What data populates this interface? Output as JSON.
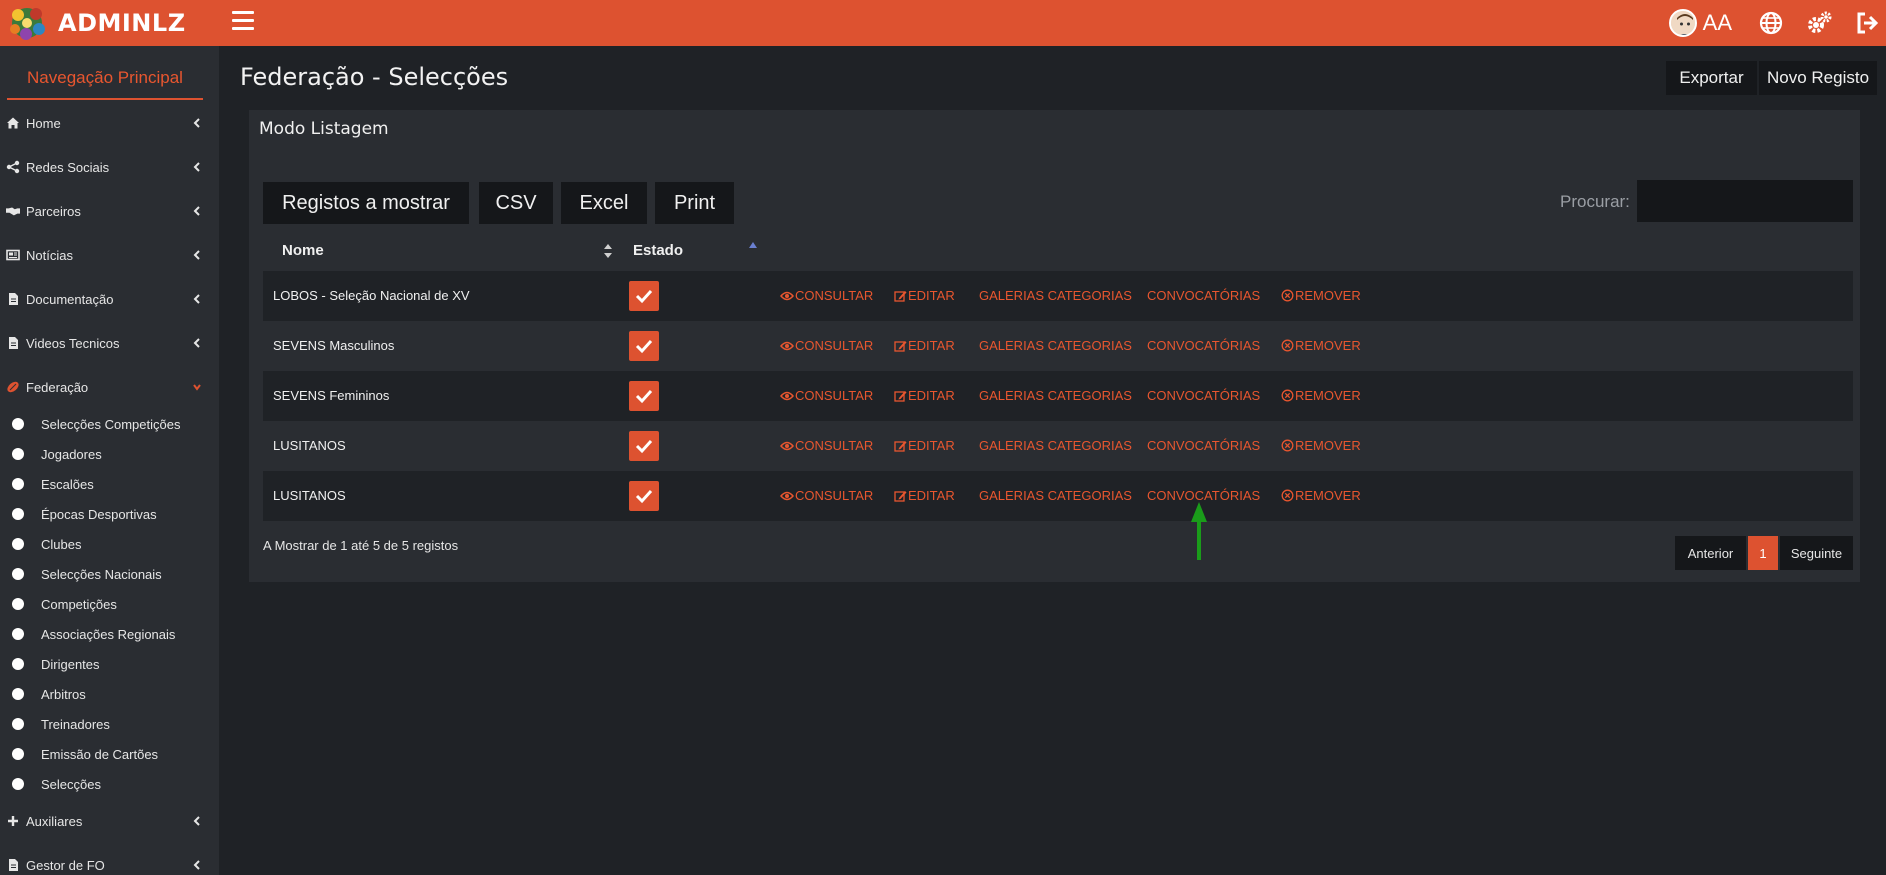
{
  "app": {
    "brand": "ADMINLZ",
    "user_initials": "AA"
  },
  "colors": {
    "accent": "#dd5230",
    "sidebar_bg": "#2a2d32",
    "body_bg": "#1f2226",
    "button_bg": "#15171a",
    "annotation_arrow": "#1a9c1a"
  },
  "sidebar": {
    "title": "Navegação Principal",
    "items": [
      {
        "label": "Home",
        "icon": "home-icon"
      },
      {
        "label": "Redes Sociais",
        "icon": "share-icon"
      },
      {
        "label": "Parceiros",
        "icon": "handshake-icon"
      },
      {
        "label": "Notícias",
        "icon": "newspaper-icon"
      },
      {
        "label": "Documentação",
        "icon": "document-icon"
      },
      {
        "label": "Videos Tecnicos",
        "icon": "document-icon"
      },
      {
        "label": "Federação",
        "icon": "rugby-ball-icon",
        "expanded": true
      },
      {
        "label": "Auxiliares",
        "icon": "plus-icon"
      },
      {
        "label": "Gestor de FO",
        "icon": "document-icon"
      }
    ],
    "federacao_items": [
      "Selecções Competições",
      "Jogadores",
      "Escalões",
      "Épocas Desportivas",
      "Clubes",
      "Selecções Nacionais",
      "Competições",
      "Associações Regionais",
      "Dirigentes",
      "Arbitros",
      "Treinadores",
      "Emissão de Cartões",
      "Selecções"
    ]
  },
  "header": {
    "page_title": "Federação - Selecções",
    "export_label": "Exportar",
    "new_label": "Novo Registo"
  },
  "panel": {
    "title": "Modo Listagem",
    "tools": [
      "Registos a mostrar",
      "CSV",
      "Excel",
      "Print"
    ],
    "search_label": "Procurar:",
    "search_value": ""
  },
  "table": {
    "columns": [
      "Nome",
      "Estado"
    ],
    "actions": [
      "CONSULTAR",
      "EDITAR",
      "GALERIAS CATEGORIAS",
      "CONVOCATÓRIAS",
      "REMOVER"
    ],
    "rows": [
      {
        "name": "LOBOS - Seleção Nacional de XV",
        "estado": true
      },
      {
        "name": "SEVENS Masculinos",
        "estado": true
      },
      {
        "name": "SEVENS Femininos",
        "estado": true
      },
      {
        "name": "LUSITANOS",
        "estado": true
      },
      {
        "name": "LUSITANOS",
        "estado": true
      }
    ]
  },
  "footer": {
    "info": "A Mostrar de 1 até 5 de 5 registos",
    "prev_label": "Anterior",
    "current_page": "1",
    "next_label": "Seguinte"
  }
}
